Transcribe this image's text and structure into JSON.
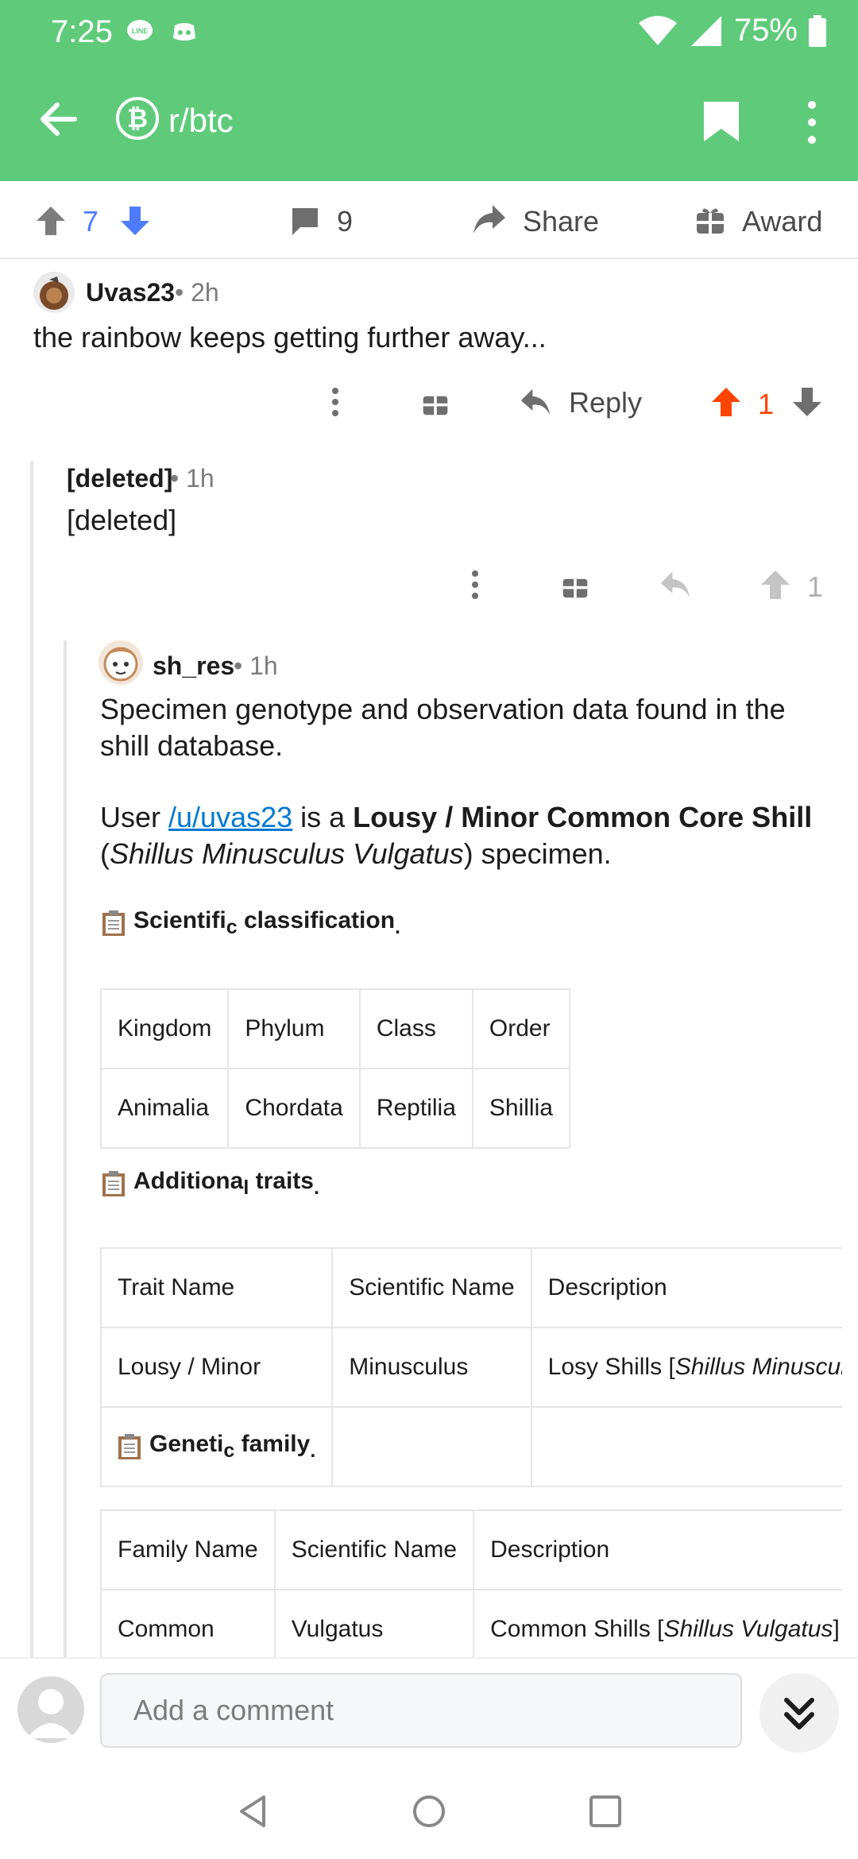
{
  "status_bar": {
    "time": "7:25",
    "battery": "75%"
  },
  "toolbar": {
    "subreddit": "r/btc",
    "sub_symbol": "₿"
  },
  "post_bar": {
    "score": "7",
    "comments": "9",
    "share": "Share",
    "award": "Award"
  },
  "comment1": {
    "author": "Uvas23",
    "time": "• 2h",
    "body": "the rainbow keeps getting further away...",
    "reply": "Reply",
    "score": "1"
  },
  "comment2": {
    "author": "[deleted]",
    "time": "• 1h",
    "body": "[deleted]",
    "score": "1"
  },
  "comment3": {
    "author": "sh_res",
    "time": "• 1h",
    "para1": "Specimen genotype and observation data found in the shill database.",
    "p2_user": "User ",
    "p2_link": "/u/uvas23",
    "p2_mid": " is a ",
    "p2_bold": "Lousy / Minor Common Core Shill",
    "p2_open": "(",
    "p2_italic": "Shillus Minusculus Vulgatus",
    "p2_end": ") specimen.",
    "sec1": {
      "a": "Scientifi",
      "b": "c",
      "c": " classificatio",
      "d": "n",
      "e": "."
    },
    "table1": {
      "headers": [
        "Kingdom",
        "Phylum",
        "Class",
        "Order"
      ],
      "row": [
        "Animalia",
        "Chordata",
        "Reptilia",
        "Shillia"
      ]
    },
    "sec2": {
      "a": "Additiona",
      "b": "l",
      "c": " traits",
      "d": "."
    },
    "table2": {
      "headers": [
        "Trait Name",
        "Scientific Name",
        "Description"
      ],
      "row": [
        "Lousy / Minor",
        "Minusculus",
        "Losy Shills ["
      ],
      "row_italic": "Shillus Minusculu"
    },
    "sec3": {
      "a": "Geneti",
      "b": "c",
      "c": " family",
      "d": "."
    },
    "table3": {
      "headers": [
        "Family Name",
        "Scientific Name",
        "Description"
      ],
      "row": [
        "Common",
        "Vulgatus",
        "Common Shills ["
      ],
      "row_italic": "Shillus Vulgatus",
      "row_tail": "] a"
    }
  },
  "composer": {
    "placeholder": "Add a comment"
  },
  "colors": {
    "header": "#5fcb7a",
    "upvote_active": "#ff4500",
    "downvote_active": "#4f7cff",
    "link": "#0079d3"
  }
}
